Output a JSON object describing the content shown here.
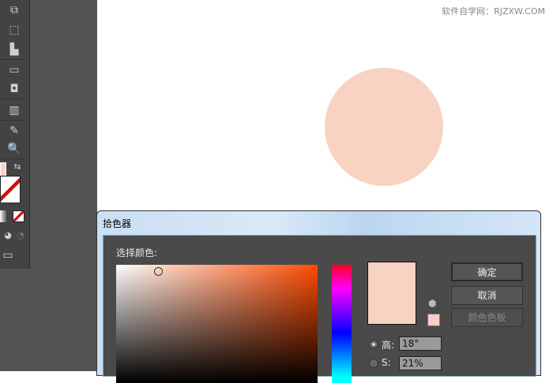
{
  "watermark": "软件自学网：RJZXW.COM",
  "fill_color": "#f8d3c2",
  "dialog": {
    "title": "拾色器",
    "select_color_label": "选择颜色:",
    "buttons": {
      "ok": "确定",
      "cancel": "取消",
      "swatches": "颜色色板"
    },
    "fields": {
      "h_label": "高:",
      "h_value": "18°",
      "s_label": "S:",
      "s_value": "21%"
    }
  },
  "tools": [
    "artboard-icon",
    "perspective-icon",
    "mesh-icon",
    "gradient-icon",
    "blend-icon",
    "graph-icon",
    "slice-icon",
    "zoom-icon"
  ]
}
